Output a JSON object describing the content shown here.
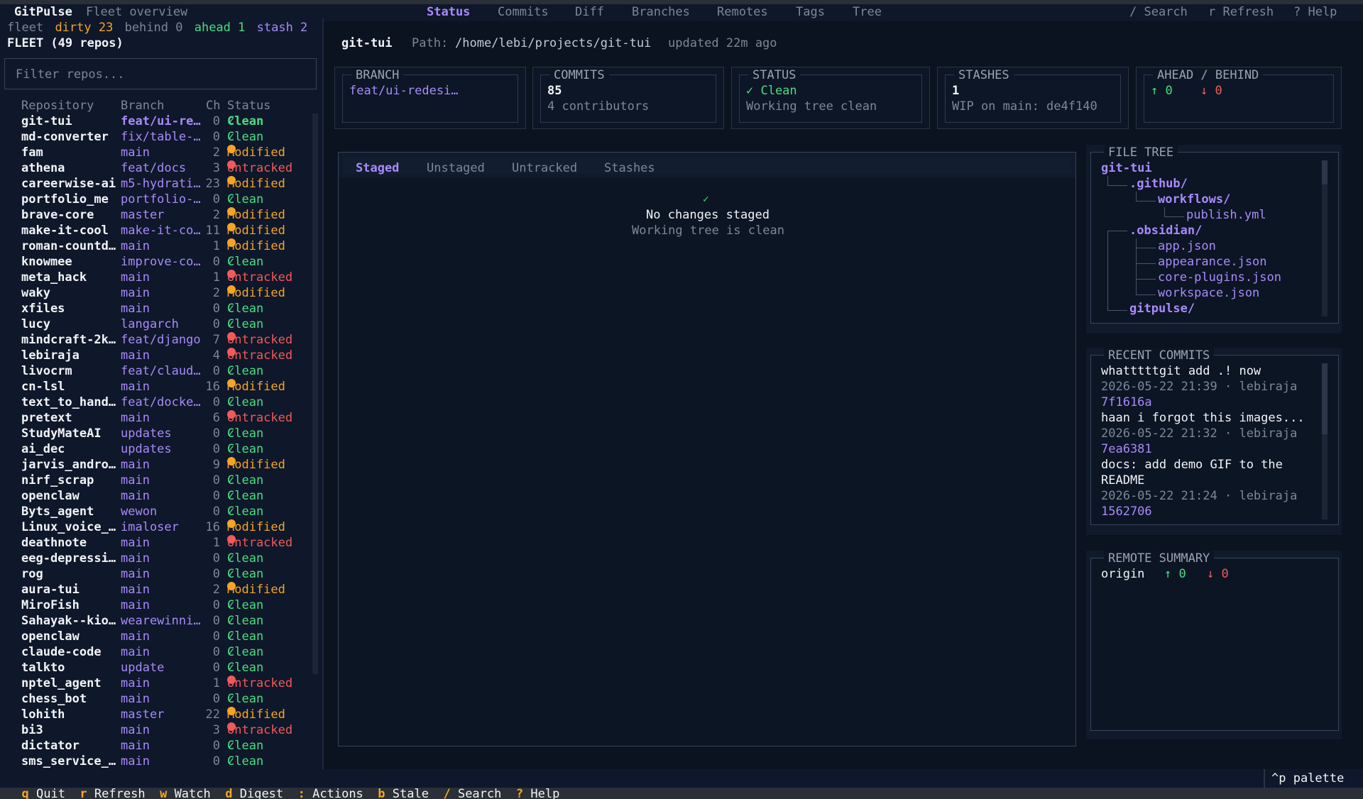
{
  "app": {
    "name": "GitPulse",
    "subtitle": "Fleet overview"
  },
  "nav": {
    "tabs": [
      "Status",
      "Commits",
      "Diff",
      "Branches",
      "Remotes",
      "Tags",
      "Tree"
    ],
    "active": "Status",
    "right": [
      "/ Search",
      "r Refresh",
      "? Help"
    ]
  },
  "fleet_stats": {
    "label": "fleet",
    "dirty": "dirty 23",
    "behind": "behind 0",
    "ahead": "ahead 1",
    "stash": "stash 2"
  },
  "sidebar": {
    "title": "FLEET (49 repos)",
    "filter_placeholder": "Filter repos...",
    "columns": [
      "Repository",
      "Branch",
      "Ch",
      "Status"
    ],
    "repos": [
      {
        "name": "git-tui",
        "branch": "feat/ui-re…",
        "ch": "0",
        "status": "Clean"
      },
      {
        "name": "md-converter",
        "branch": "fix/table-…",
        "ch": "0",
        "status": "Clean"
      },
      {
        "name": "fam",
        "branch": "main",
        "ch": "2",
        "status": "Modified"
      },
      {
        "name": "athena",
        "branch": "feat/docs",
        "ch": "3",
        "status": "Untracked"
      },
      {
        "name": "careerwise-ai",
        "branch": "m5-hydrati…",
        "ch": "23",
        "status": "Modified"
      },
      {
        "name": "portfolio_me",
        "branch": "portfolio-…",
        "ch": "0",
        "status": "Clean"
      },
      {
        "name": "brave-core",
        "branch": "master",
        "ch": "2",
        "status": "Modified"
      },
      {
        "name": "make-it-cool",
        "branch": "make-it-co…",
        "ch": "11",
        "status": "Modified"
      },
      {
        "name": "roman-countd…",
        "branch": "main",
        "ch": "1",
        "status": "Modified"
      },
      {
        "name": "knowmee",
        "branch": "improve-co…",
        "ch": "0",
        "status": "Clean"
      },
      {
        "name": "meta_hack",
        "branch": "main",
        "ch": "1",
        "status": "Untracked"
      },
      {
        "name": "waky",
        "branch": "main",
        "ch": "2",
        "status": "Modified"
      },
      {
        "name": "xfiles",
        "branch": "main",
        "ch": "0",
        "status": "Clean"
      },
      {
        "name": "lucy",
        "branch": "langarch",
        "ch": "0",
        "status": "Clean"
      },
      {
        "name": "mindcraft-2k…",
        "branch": "feat/django",
        "ch": "7",
        "status": "Untracked"
      },
      {
        "name": "lebiraja",
        "branch": "main",
        "ch": "4",
        "status": "Untracked"
      },
      {
        "name": "livocrm",
        "branch": "feat/claud…",
        "ch": "0",
        "status": "Clean"
      },
      {
        "name": "cn-lsl",
        "branch": "main",
        "ch": "16",
        "status": "Modified"
      },
      {
        "name": "text_to_hand…",
        "branch": "feat/docke…",
        "ch": "0",
        "status": "Clean"
      },
      {
        "name": "pretext",
        "branch": "main",
        "ch": "6",
        "status": "Untracked"
      },
      {
        "name": "StudyMateAI",
        "branch": "updates",
        "ch": "0",
        "status": "Clean"
      },
      {
        "name": "ai_dec",
        "branch": "updates",
        "ch": "0",
        "status": "Clean"
      },
      {
        "name": "jarvis_andro…",
        "branch": "main",
        "ch": "9",
        "status": "Modified"
      },
      {
        "name": "nirf_scrap",
        "branch": "main",
        "ch": "0",
        "status": "Clean"
      },
      {
        "name": "openclaw",
        "branch": "main",
        "ch": "0",
        "status": "Clean"
      },
      {
        "name": "Byts_agent",
        "branch": "wewon",
        "ch": "0",
        "status": "Clean"
      },
      {
        "name": "Linux_voice_…",
        "branch": "imaloser",
        "ch": "16",
        "status": "Modified"
      },
      {
        "name": "deathnote",
        "branch": "main",
        "ch": "1",
        "status": "Untracked"
      },
      {
        "name": "eeg-depressi…",
        "branch": "main",
        "ch": "0",
        "status": "Clean"
      },
      {
        "name": "rog",
        "branch": "main",
        "ch": "0",
        "status": "Clean"
      },
      {
        "name": "aura-tui",
        "branch": "main",
        "ch": "2",
        "status": "Modified"
      },
      {
        "name": "MiroFish",
        "branch": "main",
        "ch": "0",
        "status": "Clean"
      },
      {
        "name": "Sahayak--kio…",
        "branch": "wearewinni…",
        "ch": "0",
        "status": "Clean"
      },
      {
        "name": "openclaw",
        "branch": "main",
        "ch": "0",
        "status": "Clean"
      },
      {
        "name": "claude-code",
        "branch": "main",
        "ch": "0",
        "status": "Clean"
      },
      {
        "name": "talkto",
        "branch": "update",
        "ch": "0",
        "status": "Clean"
      },
      {
        "name": "nptel_agent",
        "branch": "main",
        "ch": "1",
        "status": "Untracked"
      },
      {
        "name": "chess_bot",
        "branch": "main",
        "ch": "0",
        "status": "Clean"
      },
      {
        "name": "lohith",
        "branch": "master",
        "ch": "22",
        "status": "Modified"
      },
      {
        "name": "bi3",
        "branch": "main",
        "ch": "3",
        "status": "Untracked"
      },
      {
        "name": "dictator",
        "branch": "main",
        "ch": "0",
        "status": "Clean"
      },
      {
        "name": "sms_service_…",
        "branch": "main",
        "ch": "0",
        "status": "Clean"
      }
    ]
  },
  "header": {
    "repo": "git-tui",
    "path_label": "Path:",
    "path": "/home/lebi/projects/git-tui",
    "updated": "updated 22m ago"
  },
  "cards": {
    "branch": {
      "title": "BRANCH",
      "value": "feat/ui-redesi…"
    },
    "commits": {
      "title": "COMMITS",
      "value": "85",
      "sub": "4 contributors"
    },
    "status": {
      "title": "STATUS",
      "value": "✓ Clean",
      "sub": "Working tree clean"
    },
    "stashes": {
      "title": "STASHES",
      "value": "1",
      "sub": "WIP on main: de4f140"
    },
    "ahead_behind": {
      "title": "AHEAD / BEHIND",
      "ahead": "↑ 0",
      "behind": "↓ 0"
    }
  },
  "changes": {
    "tabs": [
      "Staged",
      "Unstaged",
      "Untracked",
      "Stashes"
    ],
    "active": "Staged",
    "check": "✓",
    "empty_title": "No changes staged",
    "empty_sub": "Working tree is clean"
  },
  "file_tree": {
    "title": "FILE TREE",
    "root": "git-tui",
    "nodes": [
      ".github/",
      "workflows/",
      "publish.yml",
      ".obsidian/",
      "app.json",
      "appearance.json",
      "core-plugins.json",
      "workspace.json",
      "gitpulse/"
    ]
  },
  "recent_commits": {
    "title": "RECENT COMMITS",
    "items": [
      {
        "message": "whatttttgit add .! now",
        "meta": "2026-05-22 21:39  ·  lebiraja",
        "hash": "7f1616a"
      },
      {
        "message": "haan i forgot this images...",
        "meta": "2026-05-22 21:32  ·  lebiraja",
        "hash": "7ea6381"
      },
      {
        "message": "docs: add demo GIF to the",
        "message2": "README",
        "meta": "2026-05-22 21:24  ·  lebiraja",
        "hash": "1562706"
      }
    ]
  },
  "remote_summary": {
    "title": "REMOTE SUMMARY",
    "name": "origin",
    "ahead": "↑ 0",
    "behind": "↓ 0"
  },
  "footer": {
    "keys": [
      {
        "k": "q",
        "label": "Quit"
      },
      {
        "k": "r",
        "label": "Refresh"
      },
      {
        "k": "w",
        "label": "Watch"
      },
      {
        "k": "d",
        "label": "Digest"
      },
      {
        "k": ":",
        "label": "Actions"
      },
      {
        "k": "b",
        "label": "Stale"
      },
      {
        "k": "/",
        "label": "Search"
      },
      {
        "k": "?",
        "label": "Help"
      }
    ],
    "palette": "^p palette"
  },
  "colors": {
    "accent": "#a78bfa",
    "clean": "#4ade80",
    "modified": "#f5a524",
    "untracked": "#f05a5a",
    "bg": "#0b1220"
  }
}
